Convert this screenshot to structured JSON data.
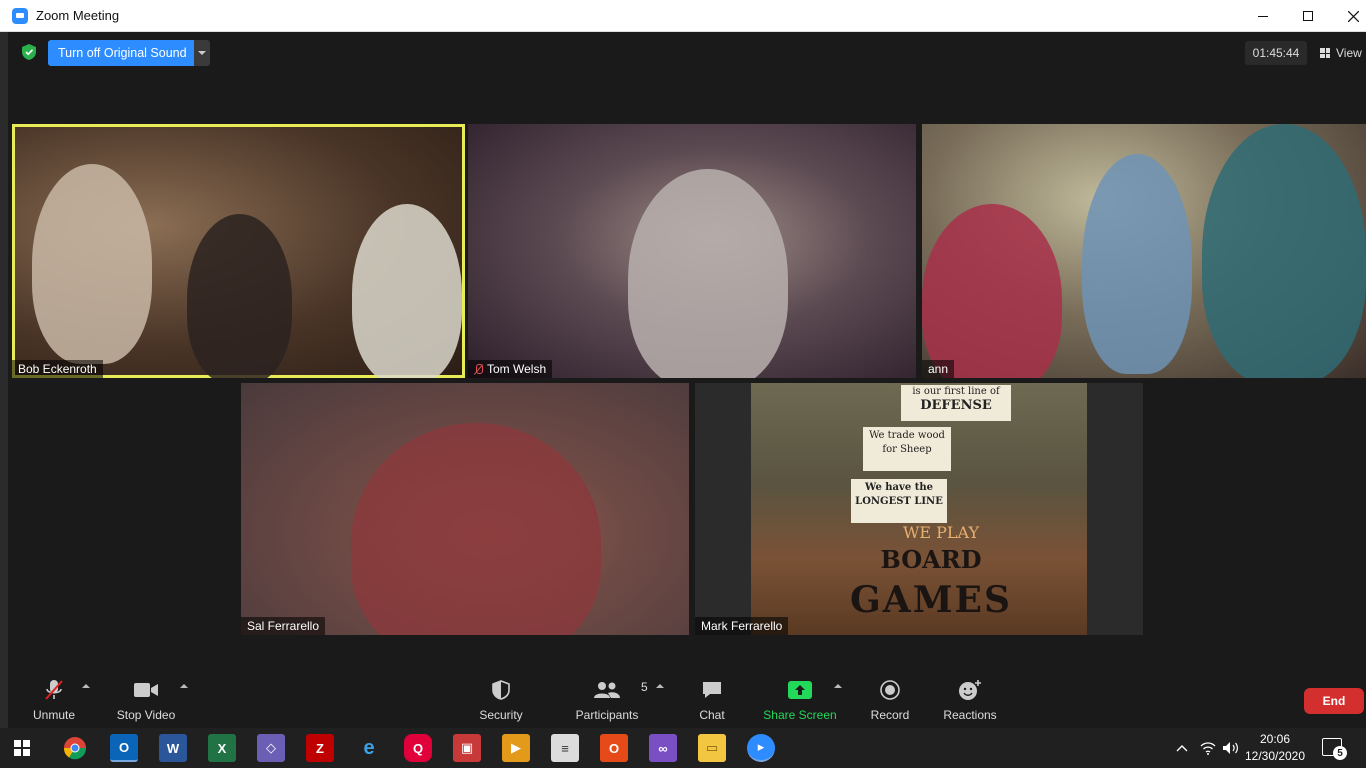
{
  "window": {
    "title": "Zoom Meeting"
  },
  "topbar": {
    "original_sound_label": "Turn off Original Sound",
    "timer": "01:45:44",
    "view_label": "View"
  },
  "participants": [
    {
      "name": "Bob Eckenroth",
      "active_speaker": true,
      "muted": false
    },
    {
      "name": "Tom Welsh",
      "active_speaker": false,
      "muted": true
    },
    {
      "name": "ann",
      "active_speaker": false,
      "muted": false
    },
    {
      "name": "Sal Ferrarello",
      "active_speaker": false,
      "muted": false
    },
    {
      "name": "Mark Ferrarello",
      "active_speaker": false,
      "muted": false
    }
  ],
  "board_sign": {
    "line1": "is our first line of",
    "line2": "DEFENSE",
    "line3": "We trade wood for Sheep",
    "line4": "We have the LONGEST LINE",
    "line5": "WE PLAY",
    "line6": "BOARD",
    "line7": "GAMES"
  },
  "toolbar": {
    "unmute_label": "Unmute",
    "stop_video_label": "Stop Video",
    "security_label": "Security",
    "participants_label": "Participants",
    "participants_count": "5",
    "chat_label": "Chat",
    "share_screen_label": "Share Screen",
    "record_label": "Record",
    "reactions_label": "Reactions",
    "end_label": "End"
  },
  "colors": {
    "zoom_blue": "#2d8cff",
    "share_green": "#23d959",
    "end_red": "#d32f2f",
    "active_speaker_yellow": "#e8ec57"
  },
  "taskbar": {
    "time": "20:06",
    "date": "12/30/2020",
    "notification_count": "5",
    "apps": [
      "chrome-icon",
      "outlook-icon",
      "word-icon",
      "excel-icon",
      "app-icon",
      "filezilla-icon",
      "ie-icon",
      "quicken-icon",
      "paint-icon",
      "media-icon",
      "notepad-icon",
      "office-icon",
      "visual-studio-icon",
      "file-explorer-icon",
      "zoom-icon"
    ]
  }
}
